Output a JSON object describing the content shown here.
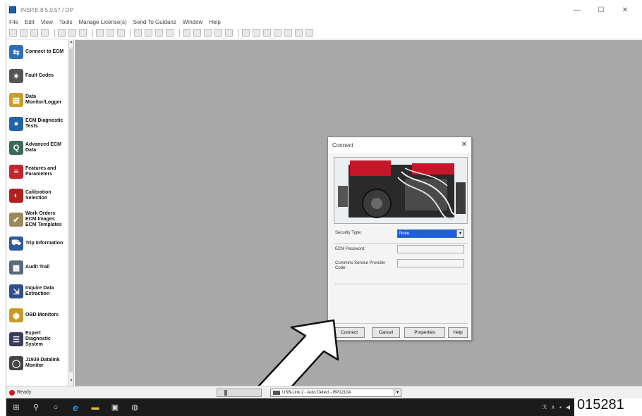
{
  "window": {
    "title": "INSITE 8.5.0.57 / DP",
    "minimize_glyph": "—",
    "maximize_glyph": "☐",
    "close_glyph": "✕"
  },
  "menu": [
    "File",
    "Edit",
    "View",
    "Tools",
    "Manage License(s)",
    "Send To Guidanz",
    "Window",
    "Help"
  ],
  "sidebar": {
    "items": [
      {
        "label": "Connect to ECM",
        "icon": "connect-icon",
        "color": "#2f6fb5",
        "glyph": "⇆"
      },
      {
        "label": "Fault Codes",
        "icon": "fault-codes-icon",
        "color": "#555555",
        "glyph": "✶"
      },
      {
        "label": "Data\nMonitor/Logger",
        "icon": "data-monitor-icon",
        "color": "#c8a02b",
        "glyph": "▤"
      },
      {
        "label": "ECM Diagnostic\nTests",
        "icon": "diagnostic-tests-icon",
        "color": "#2563a8",
        "glyph": "●"
      },
      {
        "label": "Advanced ECM\nData",
        "icon": "advanced-ecm-data-icon",
        "color": "#3a6a5a",
        "glyph": "Q"
      },
      {
        "label": "Features and\nParameters",
        "icon": "features-parameters-icon",
        "color": "#c4262e",
        "glyph": "≡"
      },
      {
        "label": "Calibration\nSelection",
        "icon": "calibration-icon",
        "color": "#b0201e",
        "glyph": "◐"
      },
      {
        "label": "Work Orders\nECM Images\nECM Templates",
        "icon": "work-orders-icon",
        "color": "#9a8a5a",
        "glyph": "✔"
      },
      {
        "label": "Trip Information",
        "icon": "trip-information-icon",
        "color": "#2e5b9a",
        "glyph": "⛟"
      },
      {
        "label": "Audit Trail",
        "icon": "audit-trail-icon",
        "color": "#5a6a7a",
        "glyph": "▦"
      },
      {
        "label": "Inquire Data\nExtraction",
        "icon": "inquire-data-icon",
        "color": "#2f4f8a",
        "glyph": "⇲"
      },
      {
        "label": "OBD Monitors",
        "icon": "obd-monitors-icon",
        "color": "#c89a2a",
        "glyph": "◉"
      },
      {
        "label": "Expert\nDiagnostic\nSystem",
        "icon": "expert-diagnostic-icon",
        "color": "#3a3a5a",
        "glyph": "☰"
      },
      {
        "label": "J1939 Datalink\nMonitor",
        "icon": "j1939-datalink-icon",
        "color": "#444444",
        "glyph": "◯"
      }
    ]
  },
  "dialog": {
    "title": "Connect",
    "close_glyph": "✕",
    "security_type_label": "Security Type:",
    "security_type_value": "None",
    "ecm_password_label": "ECM Password:",
    "ecm_password_value": "",
    "service_provider_label": "Cummins Service Provider\nCode:",
    "service_provider_value": "",
    "buttons": {
      "connect": "Connect",
      "cancel": "Cancel",
      "properties": "Properties",
      "help": "Help"
    }
  },
  "status": {
    "text": "Ready",
    "adapter": "USB-Link 2 - Auto Detect - RP1210A"
  },
  "figure_id": "015281",
  "colors": {
    "workspace": "#a8a8a8",
    "selection": "#1c5fd6",
    "status_dot": "#d21a1a"
  }
}
